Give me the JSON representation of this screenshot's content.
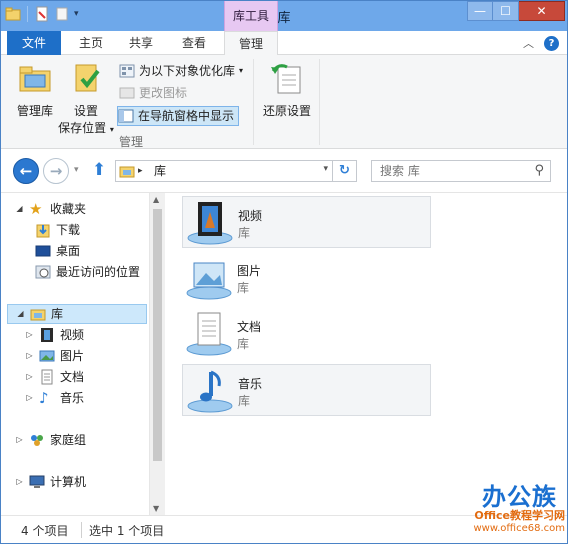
{
  "window": {
    "title": "库"
  },
  "quick_access": {
    "items": [
      "folder-icon",
      "properties-icon",
      "new-folder-icon",
      "customize-dropdown-icon"
    ]
  },
  "context_tab": {
    "label": "库工具"
  },
  "window_controls": {
    "minimize": "—",
    "maximize": "☐",
    "close": "✕"
  },
  "ribbon_tabs": [
    {
      "label": "文件"
    },
    {
      "label": "主页"
    },
    {
      "label": "共享"
    },
    {
      "label": "查看"
    },
    {
      "label": "管理"
    }
  ],
  "ribbon": {
    "manage_library": "管理库",
    "set_save_location_1": "设置",
    "set_save_location_2": "保存位置",
    "optimize_for": "为以下对象优化库",
    "change_icon": "更改图标",
    "show_in_nav": "在导航窗格中显示",
    "group_manage": "管理",
    "restore_settings": "还原设置"
  },
  "address": {
    "crumb": "库",
    "search_placeholder": "搜索 库"
  },
  "nav": {
    "favorites": "收藏夹",
    "downloads": "下载",
    "desktop": "桌面",
    "recent": "最近访问的位置",
    "libraries": "库",
    "videos": "视频",
    "pictures": "图片",
    "documents": "文档",
    "music": "音乐",
    "homegroup": "家庭组",
    "computer": "计算机"
  },
  "libraries": [
    {
      "name": "视频",
      "type": "库"
    },
    {
      "name": "图片",
      "type": "库"
    },
    {
      "name": "文档",
      "type": "库"
    },
    {
      "name": "音乐",
      "type": "库"
    }
  ],
  "status": {
    "count": "4 个项目",
    "selected": "选中 1 个项目"
  },
  "watermark": {
    "brand": "办公族",
    "line1": "Office教程学习网",
    "line2": "www.office68.com"
  },
  "colors": {
    "accent": "#1e6fc8",
    "title_bg": "#6ea8ea",
    "context_tab": "#e7c8f2",
    "selection": "#cde8fb"
  }
}
